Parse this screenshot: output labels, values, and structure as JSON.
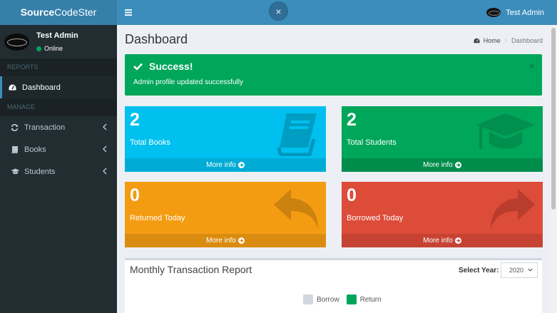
{
  "brand": {
    "bold": "Source",
    "rest": "CodeSter"
  },
  "topbar": {
    "user_name": "Test Admin",
    "close_label": "×"
  },
  "sidebar": {
    "user": {
      "name": "Test Admin",
      "status": "Online"
    },
    "reports_header": "REPORTS",
    "manage_header": "MANAGE",
    "items": [
      {
        "label": "Dashboard",
        "icon": "dashboard-icon"
      },
      {
        "label": "Transaction",
        "icon": "refresh-icon"
      },
      {
        "label": "Books",
        "icon": "book-icon"
      },
      {
        "label": "Students",
        "icon": "graduation-cap-icon"
      }
    ]
  },
  "page": {
    "title": "Dashboard"
  },
  "breadcrumb": {
    "home": "Home",
    "sep": ">",
    "current": "Dashboard"
  },
  "alert": {
    "title": "Success!",
    "message": "Admin profile updated successfully",
    "close": "×"
  },
  "boxes": [
    {
      "value": "2",
      "label": "Total Books",
      "footer": "More info",
      "icon": "book-icon",
      "color": "#00c0ef"
    },
    {
      "value": "2",
      "label": "Total Students",
      "footer": "More info",
      "icon": "graduation-cap-icon",
      "color": "#00a65a"
    },
    {
      "value": "0",
      "label": "Returned Today",
      "footer": "More info",
      "icon": "reply-icon",
      "color": "#f39c12"
    },
    {
      "value": "0",
      "label": "Borrowed Today",
      "footer": "More info",
      "icon": "share-icon",
      "color": "#dd4b39"
    }
  ],
  "report": {
    "title": "Monthly Transaction Report",
    "year_label": "Select Year:",
    "year_value": "2020",
    "legend": [
      {
        "name": "Borrow",
        "color": "#d2d6de"
      },
      {
        "name": "Return",
        "color": "#00a65a"
      }
    ]
  }
}
